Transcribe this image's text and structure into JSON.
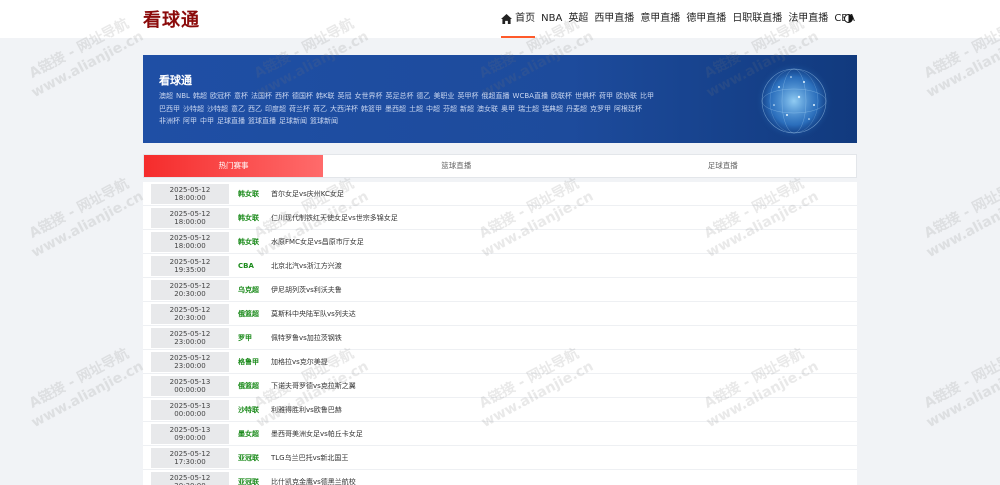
{
  "header": {
    "logo": "看球通",
    "nav": [
      {
        "label": "首页",
        "active": true,
        "icon": "home-icon"
      },
      {
        "label": "NBA"
      },
      {
        "label": "英超"
      },
      {
        "label": "西甲直播"
      },
      {
        "label": "意甲直播"
      },
      {
        "label": "德甲直播"
      },
      {
        "label": "日职联直播"
      },
      {
        "label": "法甲直播"
      },
      {
        "label": "CBA"
      }
    ],
    "theme_icon": "half-moon-icon"
  },
  "banner": {
    "title": "看球通",
    "tags": [
      "澳超",
      "NBL",
      "韩超",
      "欧冠杯",
      "意杯",
      "法国杯",
      "西杯",
      "德国杯",
      "韩K联",
      "英冠",
      "女世界杯",
      "英足总杯",
      "德乙",
      "美职业",
      "英甲杯",
      "俄超直播",
      "WCBA直播",
      "欧联杯",
      "世俱杯",
      "荷甲",
      "欧协联",
      "比甲",
      "巴西甲",
      "沙特超",
      "沙特超",
      "意乙",
      "西乙",
      "印度超",
      "荷兰杯",
      "荷乙",
      "大西洋杯",
      "韩篮甲",
      "墨西超",
      "土超",
      "中超",
      "芬超",
      "新超",
      "澳女联",
      "奥甲",
      "瑞士超",
      "瑞典超",
      "丹麦超",
      "克罗甲",
      "阿根廷杯",
      "非洲杯",
      "阿甲",
      "中甲",
      "足球直播",
      "篮球直播",
      "足球新闻",
      "篮球新闻"
    ]
  },
  "tabs": [
    "热门赛事",
    "篮球直播",
    "足球直播"
  ],
  "matches": [
    {
      "time": "2025-05-12 18:00:00",
      "league": "韩女联",
      "match": "首尔女足vs庆州KC女足"
    },
    {
      "time": "2025-05-12 18:00:00",
      "league": "韩女联",
      "match": "仁川现代制铁红天使女足vs世宗多锦女足"
    },
    {
      "time": "2025-05-12 18:00:00",
      "league": "韩女联",
      "match": "水原FMC女足vs昌原市厅女足"
    },
    {
      "time": "2025-05-12 19:35:00",
      "league": "CBA",
      "match": "北京北汽vs浙江方兴渡"
    },
    {
      "time": "2025-05-12 20:30:00",
      "league": "乌克超",
      "match": "伊尼胡列茨vs利沃夫鲁"
    },
    {
      "time": "2025-05-12 20:30:00",
      "league": "俄篮超",
      "match": "莫斯科中央陆军队vs列夫达"
    },
    {
      "time": "2025-05-12 23:00:00",
      "league": "罗甲",
      "match": "佩特罗鲁vs加拉茨钢铁"
    },
    {
      "time": "2025-05-12 23:00:00",
      "league": "格鲁甲",
      "match": "加格拉vs克尔美提"
    },
    {
      "time": "2025-05-13 00:00:00",
      "league": "俄篮超",
      "match": "下诺夫哥罗德vs克拉斯之翼"
    },
    {
      "time": "2025-05-13 00:00:00",
      "league": "沙特联",
      "match": "利雅得胜利vs欧鲁巴赫"
    },
    {
      "time": "2025-05-13 09:00:00",
      "league": "墨女超",
      "match": "墨西哥美洲女足vs帕丘卡女足"
    },
    {
      "time": "2025-05-12 17:30:00",
      "league": "亚冠联",
      "match": "TLG乌兰巴托vs新北国王"
    },
    {
      "time": "2025-05-12 20:30:00",
      "league": "亚冠联",
      "match": "比什凯克金鹰vs德黑兰航校"
    }
  ],
  "watermark": {
    "line1": "A链接 - 网址导航",
    "line2": "www.alianjie.cn"
  },
  "colors": {
    "accent": "#ff5a2a",
    "logo": "#8b0a0a",
    "league": "#1a8a1a",
    "banner": "#1f4fa5",
    "tab_active": "#f52c2c"
  }
}
